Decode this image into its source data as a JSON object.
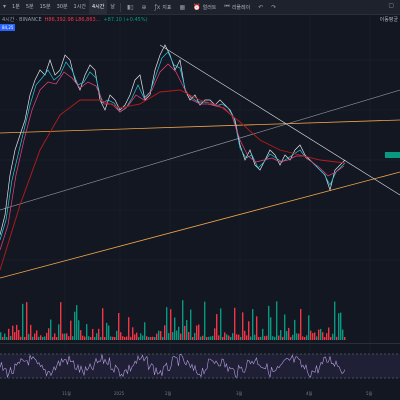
{
  "toolbar": {
    "timeframes": [
      {
        "label": "1분",
        "active": false
      },
      {
        "label": "5분",
        "active": false
      },
      {
        "label": "15분",
        "active": false
      },
      {
        "label": "30분",
        "active": false
      },
      {
        "label": "1시간",
        "active": false
      },
      {
        "label": "4시간",
        "active": true
      },
      {
        "label": "날",
        "active": false
      }
    ],
    "indicators_label": "지표",
    "alert_label": "얼러트",
    "replay_label": "리플레이"
  },
  "legend": {
    "symbol": "4시간 · BINANCE",
    "ohlc": "H86,392.98  L86,863...",
    "change": "+87.10 (+0.45%)"
  },
  "symbol_badge": "84,25",
  "side_label": "이동평균",
  "axis_labels": [
    "11월",
    "2025",
    "2월",
    "3월",
    "4월",
    "5월"
  ],
  "colors": {
    "up": "#089981",
    "down": "#f23645",
    "accent": "#2962ff",
    "trendline_orange": "#f0a64a",
    "trendline_light": "#d1d4dc",
    "rsi": "#7e57c2"
  }
}
